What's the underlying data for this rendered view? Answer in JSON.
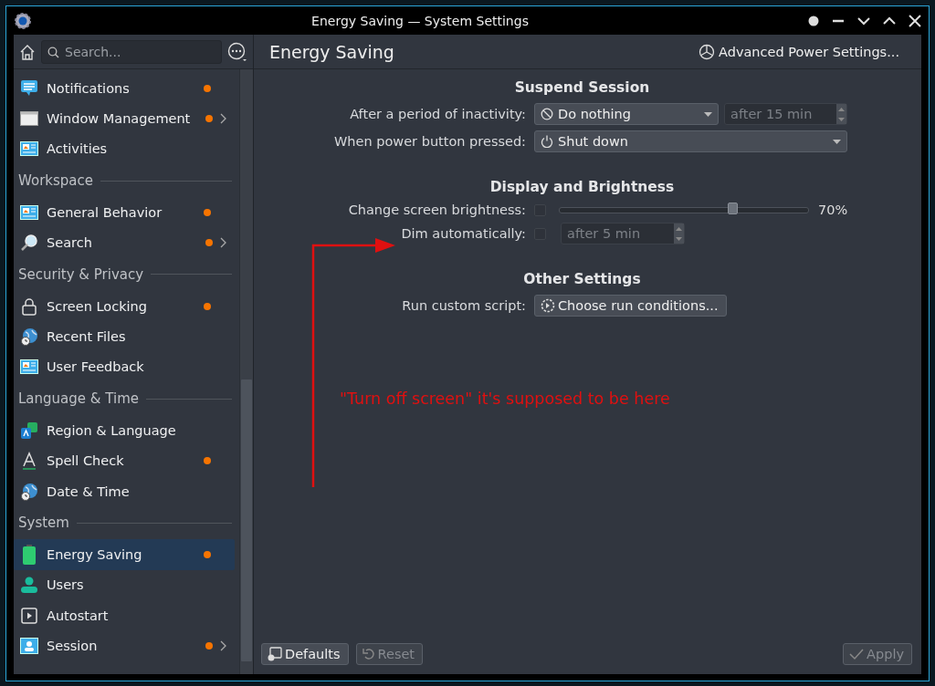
{
  "window": {
    "title": "Energy Saving — System Settings"
  },
  "sidebar": {
    "search": {
      "placeholder": "Search..."
    },
    "groups": [
      {
        "items": [
          {
            "label": "Notifications",
            "badge": true,
            "has_children": false,
            "selected": false
          },
          {
            "label": "Window Management",
            "badge": true,
            "has_children": true,
            "selected": false
          },
          {
            "label": "Activities",
            "badge": false,
            "has_children": false,
            "selected": false
          }
        ]
      },
      {
        "header": "Workspace",
        "items": [
          {
            "label": "General Behavior",
            "badge": true,
            "has_children": false,
            "selected": false
          },
          {
            "label": "Search",
            "badge": true,
            "has_children": true,
            "selected": false
          }
        ]
      },
      {
        "header": "Security & Privacy",
        "items": [
          {
            "label": "Screen Locking",
            "badge": true,
            "has_children": false,
            "selected": false
          },
          {
            "label": "Recent Files",
            "badge": false,
            "has_children": false,
            "selected": false
          },
          {
            "label": "User Feedback",
            "badge": false,
            "has_children": false,
            "selected": false
          }
        ]
      },
      {
        "header": "Language & Time",
        "items": [
          {
            "label": "Region & Language",
            "badge": false,
            "has_children": false,
            "selected": false
          },
          {
            "label": "Spell Check",
            "badge": true,
            "has_children": false,
            "selected": false
          },
          {
            "label": "Date & Time",
            "badge": false,
            "has_children": false,
            "selected": false
          }
        ]
      },
      {
        "header": "System",
        "items": [
          {
            "label": "Energy Saving",
            "badge": true,
            "has_children": false,
            "selected": true
          },
          {
            "label": "Users",
            "badge": false,
            "has_children": false,
            "selected": false
          },
          {
            "label": "Autostart",
            "badge": false,
            "has_children": false,
            "selected": false
          },
          {
            "label": "Session",
            "badge": true,
            "has_children": true,
            "selected": false
          }
        ]
      }
    ]
  },
  "page": {
    "title": "Energy Saving",
    "advanced_button": "Advanced Power Settings..."
  },
  "sections": [
    {
      "title": "Suspend Session",
      "rows": [
        {
          "kind": "combo-spin",
          "label": "After a period of inactivity:",
          "combo": "Do nothing",
          "spin": "after 15 min",
          "spin_disabled": true
        },
        {
          "kind": "combo",
          "label": "When power button pressed:",
          "combo": "Shut down"
        }
      ]
    },
    {
      "title": "Display and Brightness",
      "rows": [
        {
          "kind": "check-slider",
          "label": "Change screen brightness:",
          "checked": false,
          "level": 0.7,
          "reading": "70%"
        },
        {
          "kind": "check-spin",
          "label": "Dim automatically:",
          "checked": false,
          "spin": "after 5 min",
          "spin_disabled": true
        }
      ]
    },
    {
      "title": "Other Settings",
      "rows": [
        {
          "kind": "button",
          "label": "Run custom script:",
          "button": "Choose run conditions..."
        }
      ]
    }
  ],
  "footer": {
    "buttons": [
      {
        "label": "Defaults",
        "disabled": false
      },
      {
        "label": "Reset",
        "disabled": true
      },
      {
        "label": "Apply",
        "disabled": true
      }
    ]
  },
  "annotation": {
    "text": "\"Turn off screen\" it's supposed to be here"
  }
}
